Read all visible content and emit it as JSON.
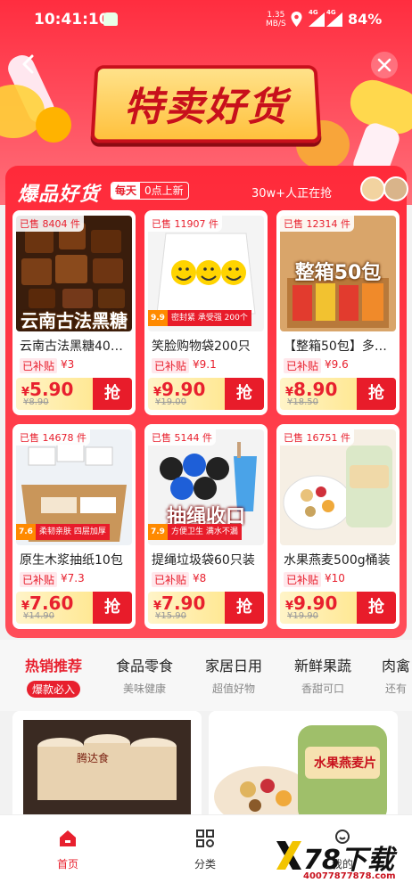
{
  "status": {
    "time": "10:41:10",
    "net_speed_value": "1.35",
    "net_speed_unit": "MB/S",
    "signal1": "4G",
    "signal2": "4G",
    "battery": "84%"
  },
  "header": {
    "banner_title": "特卖好货",
    "colors": {
      "primary_red": "#e8202e",
      "banner_gold": "#ffc13d"
    }
  },
  "section": {
    "title": "爆品好货",
    "daily_label": "每天",
    "refresh_text": "0点上新",
    "grab_count": "30w+人正在抢"
  },
  "products": [
    {
      "sold": "已售 8404 件",
      "overlay": "云南古法黑糖",
      "name": "云南古法黑糖40…",
      "subsidy_label": "已补贴",
      "subsidy": "¥3",
      "yen": "¥",
      "price": "5.90",
      "old_price": "¥8.90",
      "grab": "抢"
    },
    {
      "sold": "已售 11907 件",
      "band_a": "9.9",
      "band_b": "密封紧 承受强 200个",
      "name": "笑脸购物袋200只",
      "subsidy_label": "已补贴",
      "subsidy": "¥9.1",
      "yen": "¥",
      "price": "9.90",
      "old_price": "¥19.00",
      "grab": "抢"
    },
    {
      "sold": "已售 12314 件",
      "overlay": "整箱50包",
      "name": "【整箱50包】多…",
      "subsidy_label": "已补贴",
      "subsidy": "¥9.6",
      "yen": "¥",
      "price": "8.90",
      "old_price": "¥18.50",
      "grab": "抢"
    },
    {
      "sold": "已售 14678 件",
      "band_a": "7.6",
      "band_b": "柔韧亲肤 四层加厚",
      "name": "原生木浆抽纸10包",
      "subsidy_label": "已补贴",
      "subsidy": "¥7.3",
      "yen": "¥",
      "price": "7.60",
      "old_price": "¥14.90",
      "grab": "抢"
    },
    {
      "sold": "已售 5144 件",
      "overlay": "抽绳收口",
      "band_a": "7.9",
      "band_b": "方便卫生 满水不漏",
      "name": "提绳垃圾袋60只装",
      "subsidy_label": "已补贴",
      "subsidy": "¥8",
      "yen": "¥",
      "price": "7.90",
      "old_price": "¥15.90",
      "grab": "抢"
    },
    {
      "sold": "已售 16751 件",
      "name": "水果燕麦500g桶装",
      "subsidy_label": "已补贴",
      "subsidy": "¥10",
      "yen": "¥",
      "price": "9.90",
      "old_price": "¥19.90",
      "grab": "抢"
    }
  ],
  "categories": [
    {
      "label": "热销推荐",
      "sub": "爆款必入"
    },
    {
      "label": "食品零食",
      "sub": "美味健康"
    },
    {
      "label": "家居日用",
      "sub": "超值好物"
    },
    {
      "label": "新鲜果蔬",
      "sub": "香甜可口"
    },
    {
      "label": "肉禽",
      "sub": "还有"
    }
  ],
  "feed": {
    "left_label": "腾达食",
    "right_label": "水果燕麦片"
  },
  "nav": {
    "home": "首页",
    "category": "分类",
    "mine": "我的"
  },
  "watermark": {
    "main": "78下载",
    "url": "40077877878.com"
  }
}
